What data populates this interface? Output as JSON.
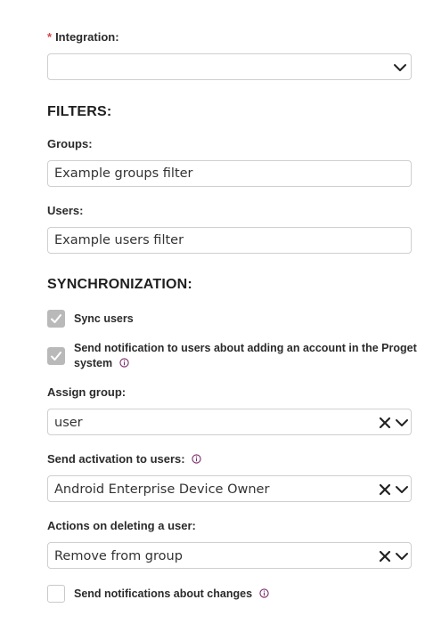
{
  "integration": {
    "label": "Integration:",
    "required_mark": "*",
    "value": ""
  },
  "filters": {
    "title": "FILTERS:",
    "groups_label": "Groups:",
    "groups_value": "Example groups filter",
    "users_label": "Users:",
    "users_value": "Example users filter"
  },
  "sync": {
    "title": "SYNCHRONIZATION:",
    "sync_users_label": "Sync users",
    "sync_users_checked": true,
    "notify_label_line1": "Send notification to users about adding an account in the Proget",
    "notify_label_line2": "system",
    "notify_checked": true,
    "assign_group_label": "Assign group:",
    "assign_group_value": "user",
    "activation_label": "Send activation to users:",
    "activation_value": "Android Enterprise Device Owner",
    "delete_actions_label": "Actions on deleting a user:",
    "delete_actions_value": "Remove from group",
    "changes_notify_label": "Send notifications about changes",
    "changes_notify_checked": false
  },
  "colors": {
    "required": "#d64545",
    "accent": "#7a2a6a",
    "checkbox_checked": "#b9b9b9"
  },
  "icons": {
    "select": "chevron-down-icon",
    "clear": "clear-x-icon",
    "info": "info-icon",
    "check": "checkmark-icon"
  }
}
